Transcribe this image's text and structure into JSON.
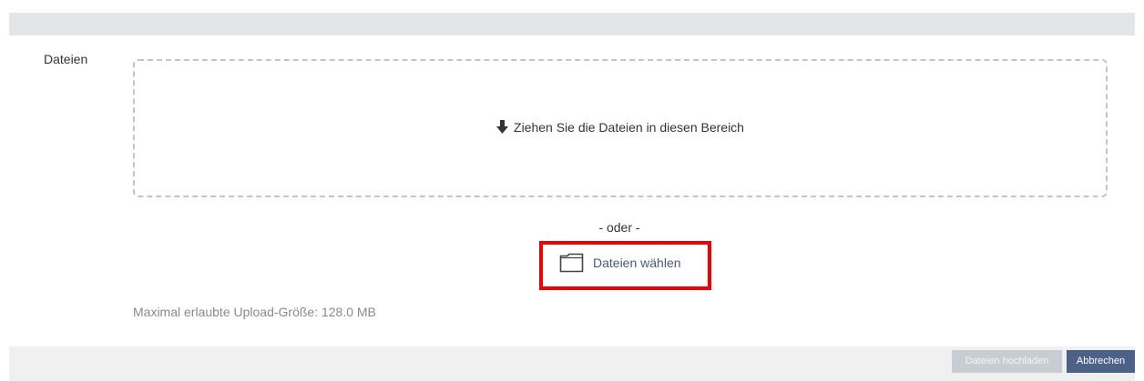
{
  "form": {
    "field_label": "Dateien",
    "dropzone_text": "Ziehen Sie die Dateien in diesen Bereich",
    "or_text": "- oder -",
    "choose_files_label": "Dateien wählen",
    "max_upload_text": "Maximal erlaubte Upload-Größe: 128.0 MB"
  },
  "footer": {
    "upload_button_label": "Dateien hochladen",
    "cancel_button_label": "Abbrechen"
  },
  "icons": {
    "dropzone": "arrow-down-icon",
    "choose": "folder-icon"
  },
  "colors": {
    "highlight": "#ee0000",
    "primary_button": "#4d6287",
    "disabled_button": "#c8ccd3",
    "link": "#4a5a7a"
  },
  "state": {
    "upload_button_disabled": true
  }
}
